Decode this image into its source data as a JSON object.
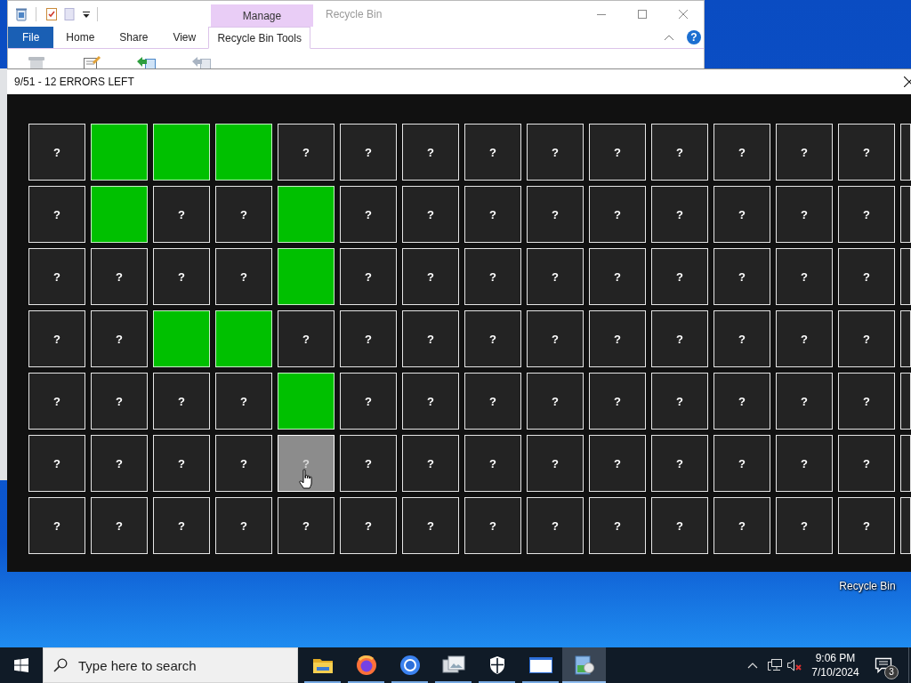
{
  "explorer_window": {
    "title": "Recycle Bin",
    "context_group": "Manage",
    "ribbon_tabs": [
      {
        "label": "File",
        "kind": "file",
        "selected": false
      },
      {
        "label": "Home",
        "kind": "plain",
        "selected": false
      },
      {
        "label": "Share",
        "kind": "plain",
        "selected": false
      },
      {
        "label": "View",
        "kind": "plain",
        "selected": false
      },
      {
        "label": "Recycle Bin Tools",
        "kind": "contextual",
        "selected": true
      }
    ],
    "help_label": "?",
    "ribbon_buttons": [
      {
        "kind": "bin",
        "disabled": true
      },
      {
        "kind": "properties",
        "disabled": false
      },
      {
        "kind": "restore",
        "disabled": false
      },
      {
        "kind": "restore",
        "disabled": true
      }
    ]
  },
  "game_window": {
    "title": "9/51 - 12 ERRORS LEFT",
    "grid": {
      "rows": [
        {
          "cells": [
            {
              "found": false,
              "hovered": false,
              "label": "?"
            },
            {
              "found": true,
              "hovered": false
            },
            {
              "found": true,
              "hovered": false
            },
            {
              "found": true,
              "hovered": false
            },
            {
              "found": false,
              "hovered": false,
              "label": "?"
            },
            {
              "found": false,
              "hovered": false,
              "label": "?"
            },
            {
              "found": false,
              "hovered": false,
              "label": "?"
            },
            {
              "found": false,
              "hovered": false,
              "label": "?"
            },
            {
              "found": false,
              "hovered": false,
              "label": "?"
            },
            {
              "found": false,
              "hovered": false,
              "label": "?"
            },
            {
              "found": false,
              "hovered": false,
              "label": "?"
            },
            {
              "found": false,
              "hovered": false,
              "label": "?"
            },
            {
              "found": false,
              "hovered": false,
              "label": "?"
            },
            {
              "found": false,
              "hovered": false,
              "label": "?"
            },
            {
              "found": false,
              "hovered": false
            }
          ]
        },
        {
          "cells": [
            {
              "found": false,
              "hovered": false,
              "label": "?"
            },
            {
              "found": true,
              "hovered": false
            },
            {
              "found": false,
              "hovered": false,
              "label": "?"
            },
            {
              "found": false,
              "hovered": false,
              "label": "?"
            },
            {
              "found": true,
              "hovered": false
            },
            {
              "found": false,
              "hovered": false,
              "label": "?"
            },
            {
              "found": false,
              "hovered": false,
              "label": "?"
            },
            {
              "found": false,
              "hovered": false,
              "label": "?"
            },
            {
              "found": false,
              "hovered": false,
              "label": "?"
            },
            {
              "found": false,
              "hovered": false,
              "label": "?"
            },
            {
              "found": false,
              "hovered": false,
              "label": "?"
            },
            {
              "found": false,
              "hovered": false,
              "label": "?"
            },
            {
              "found": false,
              "hovered": false,
              "label": "?"
            },
            {
              "found": false,
              "hovered": false,
              "label": "?"
            },
            {
              "found": false,
              "hovered": false
            }
          ]
        },
        {
          "cells": [
            {
              "found": false,
              "hovered": false,
              "label": "?"
            },
            {
              "found": false,
              "hovered": false,
              "label": "?"
            },
            {
              "found": false,
              "hovered": false,
              "label": "?"
            },
            {
              "found": false,
              "hovered": false,
              "label": "?"
            },
            {
              "found": true,
              "hovered": false
            },
            {
              "found": false,
              "hovered": false,
              "label": "?"
            },
            {
              "found": false,
              "hovered": false,
              "label": "?"
            },
            {
              "found": false,
              "hovered": false,
              "label": "?"
            },
            {
              "found": false,
              "hovered": false,
              "label": "?"
            },
            {
              "found": false,
              "hovered": false,
              "label": "?"
            },
            {
              "found": false,
              "hovered": false,
              "label": "?"
            },
            {
              "found": false,
              "hovered": false,
              "label": "?"
            },
            {
              "found": false,
              "hovered": false,
              "label": "?"
            },
            {
              "found": false,
              "hovered": false,
              "label": "?"
            },
            {
              "found": false,
              "hovered": false
            }
          ]
        },
        {
          "cells": [
            {
              "found": false,
              "hovered": false,
              "label": "?"
            },
            {
              "found": false,
              "hovered": false,
              "label": "?"
            },
            {
              "found": true,
              "hovered": false
            },
            {
              "found": true,
              "hovered": false
            },
            {
              "found": false,
              "hovered": false,
              "label": "?"
            },
            {
              "found": false,
              "hovered": false,
              "label": "?"
            },
            {
              "found": false,
              "hovered": false,
              "label": "?"
            },
            {
              "found": false,
              "hovered": false,
              "label": "?"
            },
            {
              "found": false,
              "hovered": false,
              "label": "?"
            },
            {
              "found": false,
              "hovered": false,
              "label": "?"
            },
            {
              "found": false,
              "hovered": false,
              "label": "?"
            },
            {
              "found": false,
              "hovered": false,
              "label": "?"
            },
            {
              "found": false,
              "hovered": false,
              "label": "?"
            },
            {
              "found": false,
              "hovered": false,
              "label": "?"
            },
            {
              "found": false,
              "hovered": false
            }
          ]
        },
        {
          "cells": [
            {
              "found": false,
              "hovered": false,
              "label": "?"
            },
            {
              "found": false,
              "hovered": false,
              "label": "?"
            },
            {
              "found": false,
              "hovered": false,
              "label": "?"
            },
            {
              "found": false,
              "hovered": false,
              "label": "?"
            },
            {
              "found": true,
              "hovered": false
            },
            {
              "found": false,
              "hovered": false,
              "label": "?"
            },
            {
              "found": false,
              "hovered": false,
              "label": "?"
            },
            {
              "found": false,
              "hovered": false,
              "label": "?"
            },
            {
              "found": false,
              "hovered": false,
              "label": "?"
            },
            {
              "found": false,
              "hovered": false,
              "label": "?"
            },
            {
              "found": false,
              "hovered": false,
              "label": "?"
            },
            {
              "found": false,
              "hovered": false,
              "label": "?"
            },
            {
              "found": false,
              "hovered": false,
              "label": "?"
            },
            {
              "found": false,
              "hovered": false,
              "label": "?"
            },
            {
              "found": false,
              "hovered": false
            }
          ]
        },
        {
          "cells": [
            {
              "found": false,
              "hovered": false,
              "label": "?"
            },
            {
              "found": false,
              "hovered": false,
              "label": "?"
            },
            {
              "found": false,
              "hovered": false,
              "label": "?"
            },
            {
              "found": false,
              "hovered": false,
              "label": "?"
            },
            {
              "found": false,
              "hovered": true,
              "label": "?"
            },
            {
              "found": false,
              "hovered": false,
              "label": "?"
            },
            {
              "found": false,
              "hovered": false,
              "label": "?"
            },
            {
              "found": false,
              "hovered": false,
              "label": "?"
            },
            {
              "found": false,
              "hovered": false,
              "label": "?"
            },
            {
              "found": false,
              "hovered": false,
              "label": "?"
            },
            {
              "found": false,
              "hovered": false,
              "label": "?"
            },
            {
              "found": false,
              "hovered": false,
              "label": "?"
            },
            {
              "found": false,
              "hovered": false,
              "label": "?"
            },
            {
              "found": false,
              "hovered": false,
              "label": "?"
            },
            {
              "found": false,
              "hovered": false
            }
          ]
        },
        {
          "cells": [
            {
              "found": false,
              "hovered": false,
              "label": "?"
            },
            {
              "found": false,
              "hovered": false,
              "label": "?"
            },
            {
              "found": false,
              "hovered": false,
              "label": "?"
            },
            {
              "found": false,
              "hovered": false,
              "label": "?"
            },
            {
              "found": false,
              "hovered": false,
              "label": "?"
            },
            {
              "found": false,
              "hovered": false,
              "label": "?"
            },
            {
              "found": false,
              "hovered": false,
              "label": "?"
            },
            {
              "found": false,
              "hovered": false,
              "label": "?"
            },
            {
              "found": false,
              "hovered": false,
              "label": "?"
            },
            {
              "found": false,
              "hovered": false,
              "label": "?"
            },
            {
              "found": false,
              "hovered": false,
              "label": "?"
            },
            {
              "found": false,
              "hovered": false,
              "label": "?"
            },
            {
              "found": false,
              "hovered": false,
              "label": "?"
            },
            {
              "found": false,
              "hovered": false,
              "label": "?"
            },
            {
              "found": false,
              "hovered": false
            }
          ]
        }
      ]
    }
  },
  "desktop": {
    "icons": [
      {
        "label": "Recycle Bin"
      }
    ]
  },
  "taskbar": {
    "search": {
      "placeholder": "Type here to search"
    },
    "apps": [
      {
        "kind": "folder",
        "running": true,
        "active": false
      },
      {
        "kind": "browser",
        "running": true,
        "active": false
      },
      {
        "kind": "ring",
        "running": true,
        "active": false
      },
      {
        "kind": "images",
        "running": true,
        "active": false
      },
      {
        "kind": "shield",
        "running": true,
        "active": false
      },
      {
        "kind": "window",
        "running": true,
        "active": false
      },
      {
        "kind": "app",
        "running": true,
        "active": true
      }
    ],
    "clock": {
      "time": "9:06 PM",
      "date": "7/10/2024"
    },
    "notifications": {
      "count": "3"
    }
  }
}
